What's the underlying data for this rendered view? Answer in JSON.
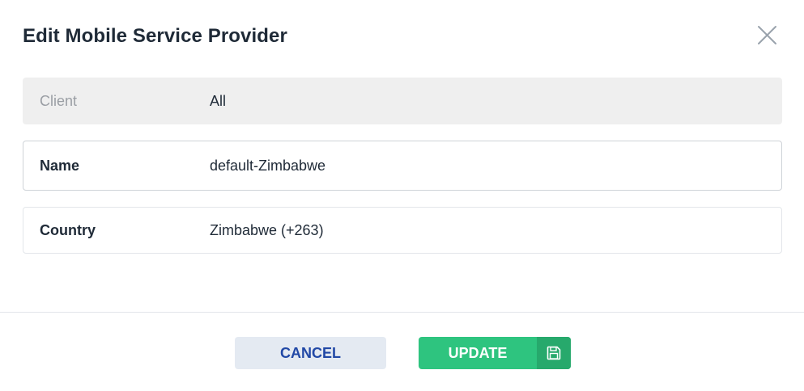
{
  "dialog": {
    "title": "Edit Mobile Service Provider",
    "close_icon": "close-icon"
  },
  "fields": {
    "client": {
      "label": "Client",
      "value": "All"
    },
    "name": {
      "label": "Name",
      "value": "default-Zimbabwe"
    },
    "country": {
      "label": "Country",
      "value": "Zimbabwe (+263)"
    }
  },
  "footer": {
    "cancel_label": "CANCEL",
    "update_label": "UPDATE",
    "update_icon": "save-icon"
  },
  "colors": {
    "accent_green": "#2ec47f",
    "accent_green_dark": "#27a96c",
    "cancel_bg": "#e4eaf2",
    "cancel_text": "#2148a6",
    "readonly_bg": "#efefef"
  }
}
